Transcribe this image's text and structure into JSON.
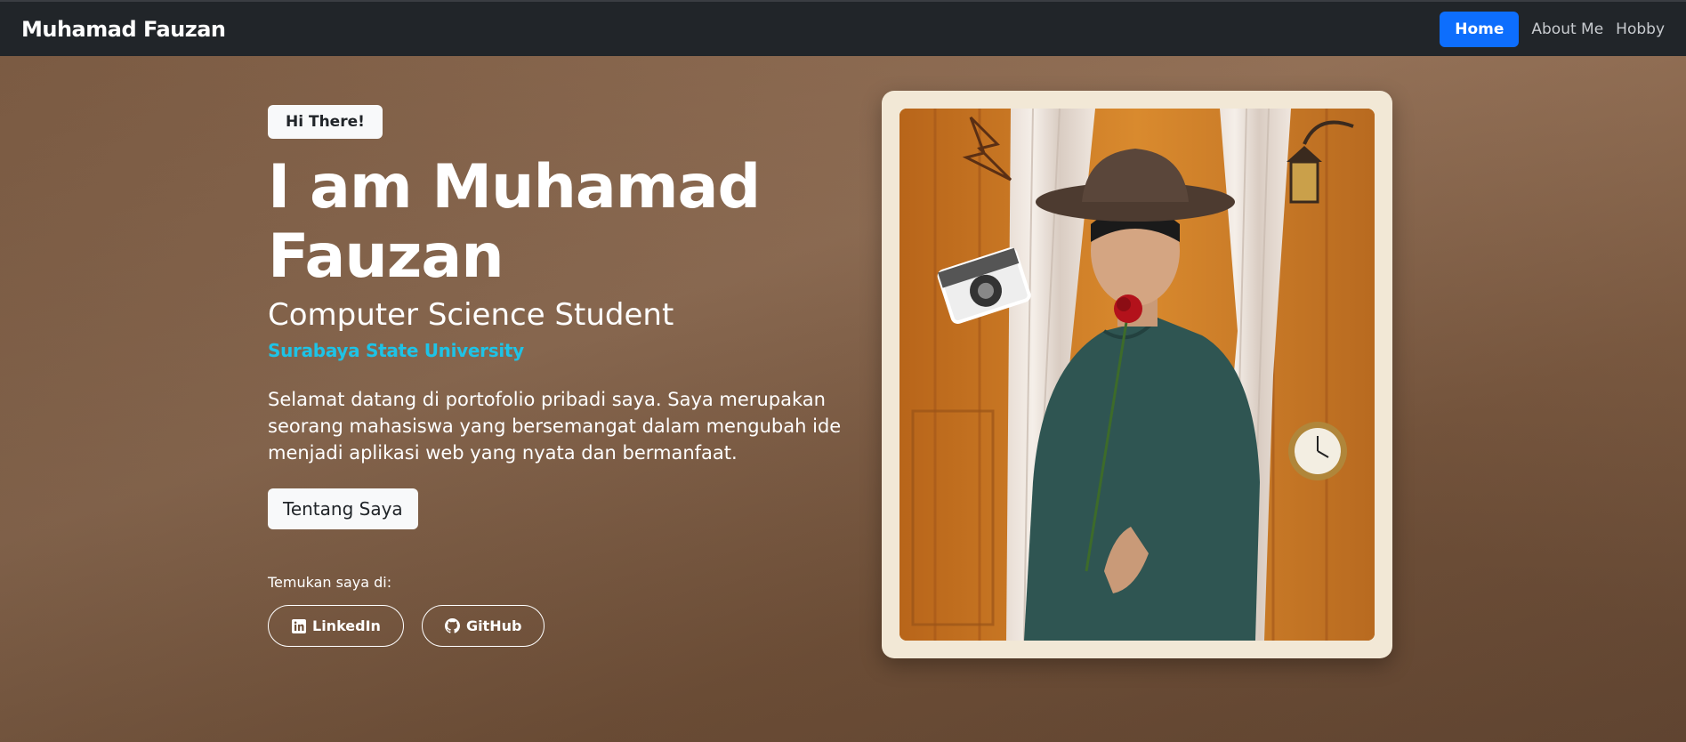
{
  "navbar": {
    "brand": "Muhamad Fauzan",
    "links": [
      {
        "label": "Home",
        "active": true
      },
      {
        "label": "About Me",
        "active": false
      },
      {
        "label": "Hobby",
        "active": false
      }
    ]
  },
  "hero": {
    "badge": "Hi There!",
    "title": "I am Muhamad Fauzan",
    "subtitle": "Computer Science Student",
    "university": "Surabaya State University",
    "description": "Selamat datang di portofolio pribadi saya. Saya merupakan seorang mahasiswa yang bersemangat dalam mengubah ide menjadi aplikasi web yang nyata dan bermanfaat.",
    "about_button": "Tentang Saya",
    "find_label": "Temukan saya di:",
    "social": [
      {
        "label": "LinkedIn",
        "icon": "linkedin-icon"
      },
      {
        "label": "GitHub",
        "icon": "github-icon"
      }
    ]
  },
  "colors": {
    "navbar_bg": "#212529",
    "accent": "#0d6efd",
    "university": "#1ec3e6",
    "card_frame": "#f2e8d6"
  }
}
